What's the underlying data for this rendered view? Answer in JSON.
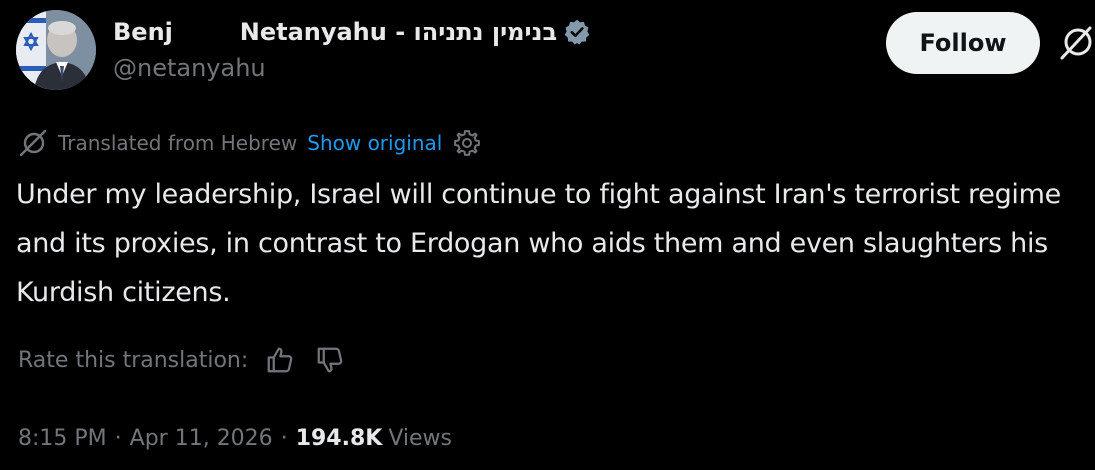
{
  "author": {
    "display_name": "Benj        Netanyahu - בנימין נתניהו",
    "handle": "@netanyahu",
    "verified_color": "#829aab"
  },
  "header": {
    "follow_label": "Follow",
    "grok_icon": "grok-icon"
  },
  "translation": {
    "notice": "Translated from Hebrew",
    "show_original": "Show original",
    "icon": "translate-icon",
    "settings_icon": "gear-icon"
  },
  "tweet": {
    "text": "Under my leadership, Israel will continue to fight against Iran's terrorist regime and its proxies, in contrast to Erdogan who aids them and even slaughters his Kurdish citizens."
  },
  "rating": {
    "label": "Rate this translation:",
    "thumbs_up_icon": "thumbs-up-icon",
    "thumbs_down_icon": "thumbs-down-icon"
  },
  "meta": {
    "time": "8:15 PM",
    "separator": "·",
    "date": "Apr 11, 2026",
    "views_count": "194.8K",
    "views_label": "Views"
  },
  "colors": {
    "background": "#000000",
    "text_primary": "#e7e9ea",
    "text_secondary": "#71767b",
    "link_blue": "#1d9bf0",
    "follow_bg": "#eff3f4"
  }
}
